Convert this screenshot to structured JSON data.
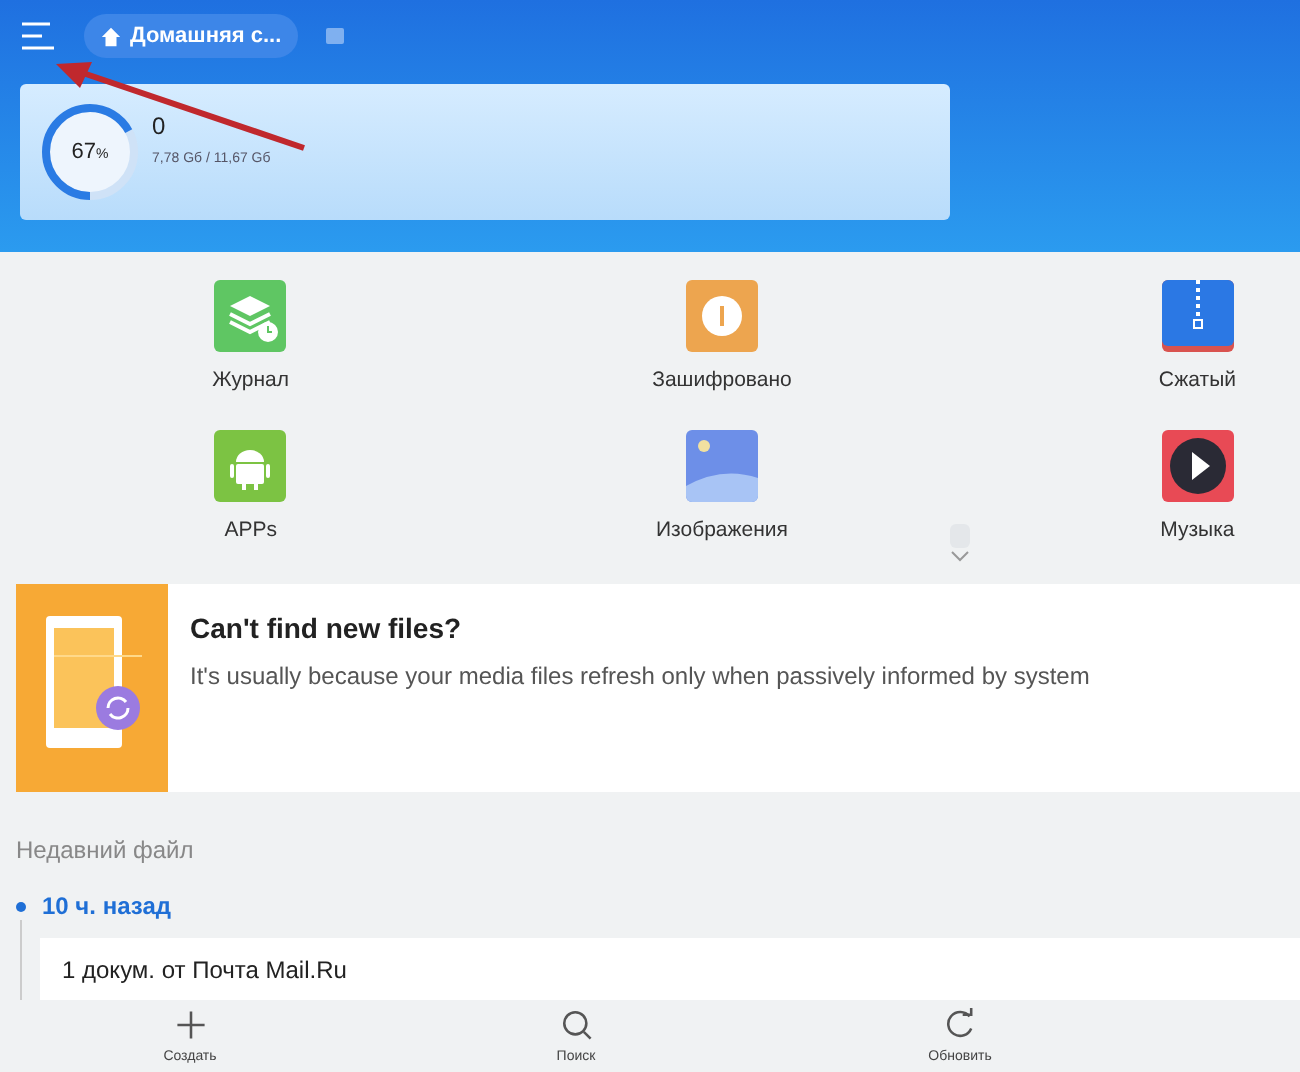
{
  "top_bar": {
    "breadcrumb": "Домашняя с..."
  },
  "storage": {
    "percent": "67",
    "percent_unit": "%",
    "level": 0.67,
    "title": "0",
    "usage": "7,78 Gб / 11,67 Gб"
  },
  "categories": [
    {
      "label": "Журнал",
      "kind": "history"
    },
    {
      "label": "Зашифровано",
      "kind": "encrypted"
    },
    {
      "label": "Сжатый",
      "kind": "archive"
    },
    {
      "label": "APPs",
      "kind": "apps"
    },
    {
      "label": "Изображения",
      "kind": "images"
    },
    {
      "label": "Музыка",
      "kind": "music"
    }
  ],
  "tip": {
    "title": "Can't find new files?",
    "text": "It's usually because your media files refresh only when passively informed by system"
  },
  "recent": {
    "heading": "Недавний файл",
    "groups": [
      {
        "time": "10 ч. назад",
        "items": [
          {
            "title": "1 докум. от Почта Mail.Ru"
          }
        ]
      }
    ]
  },
  "bottom_bar": [
    {
      "label": "Создать",
      "kind": "create"
    },
    {
      "label": "Поиск",
      "kind": "search"
    },
    {
      "label": "Обновить",
      "kind": "refresh"
    }
  ]
}
